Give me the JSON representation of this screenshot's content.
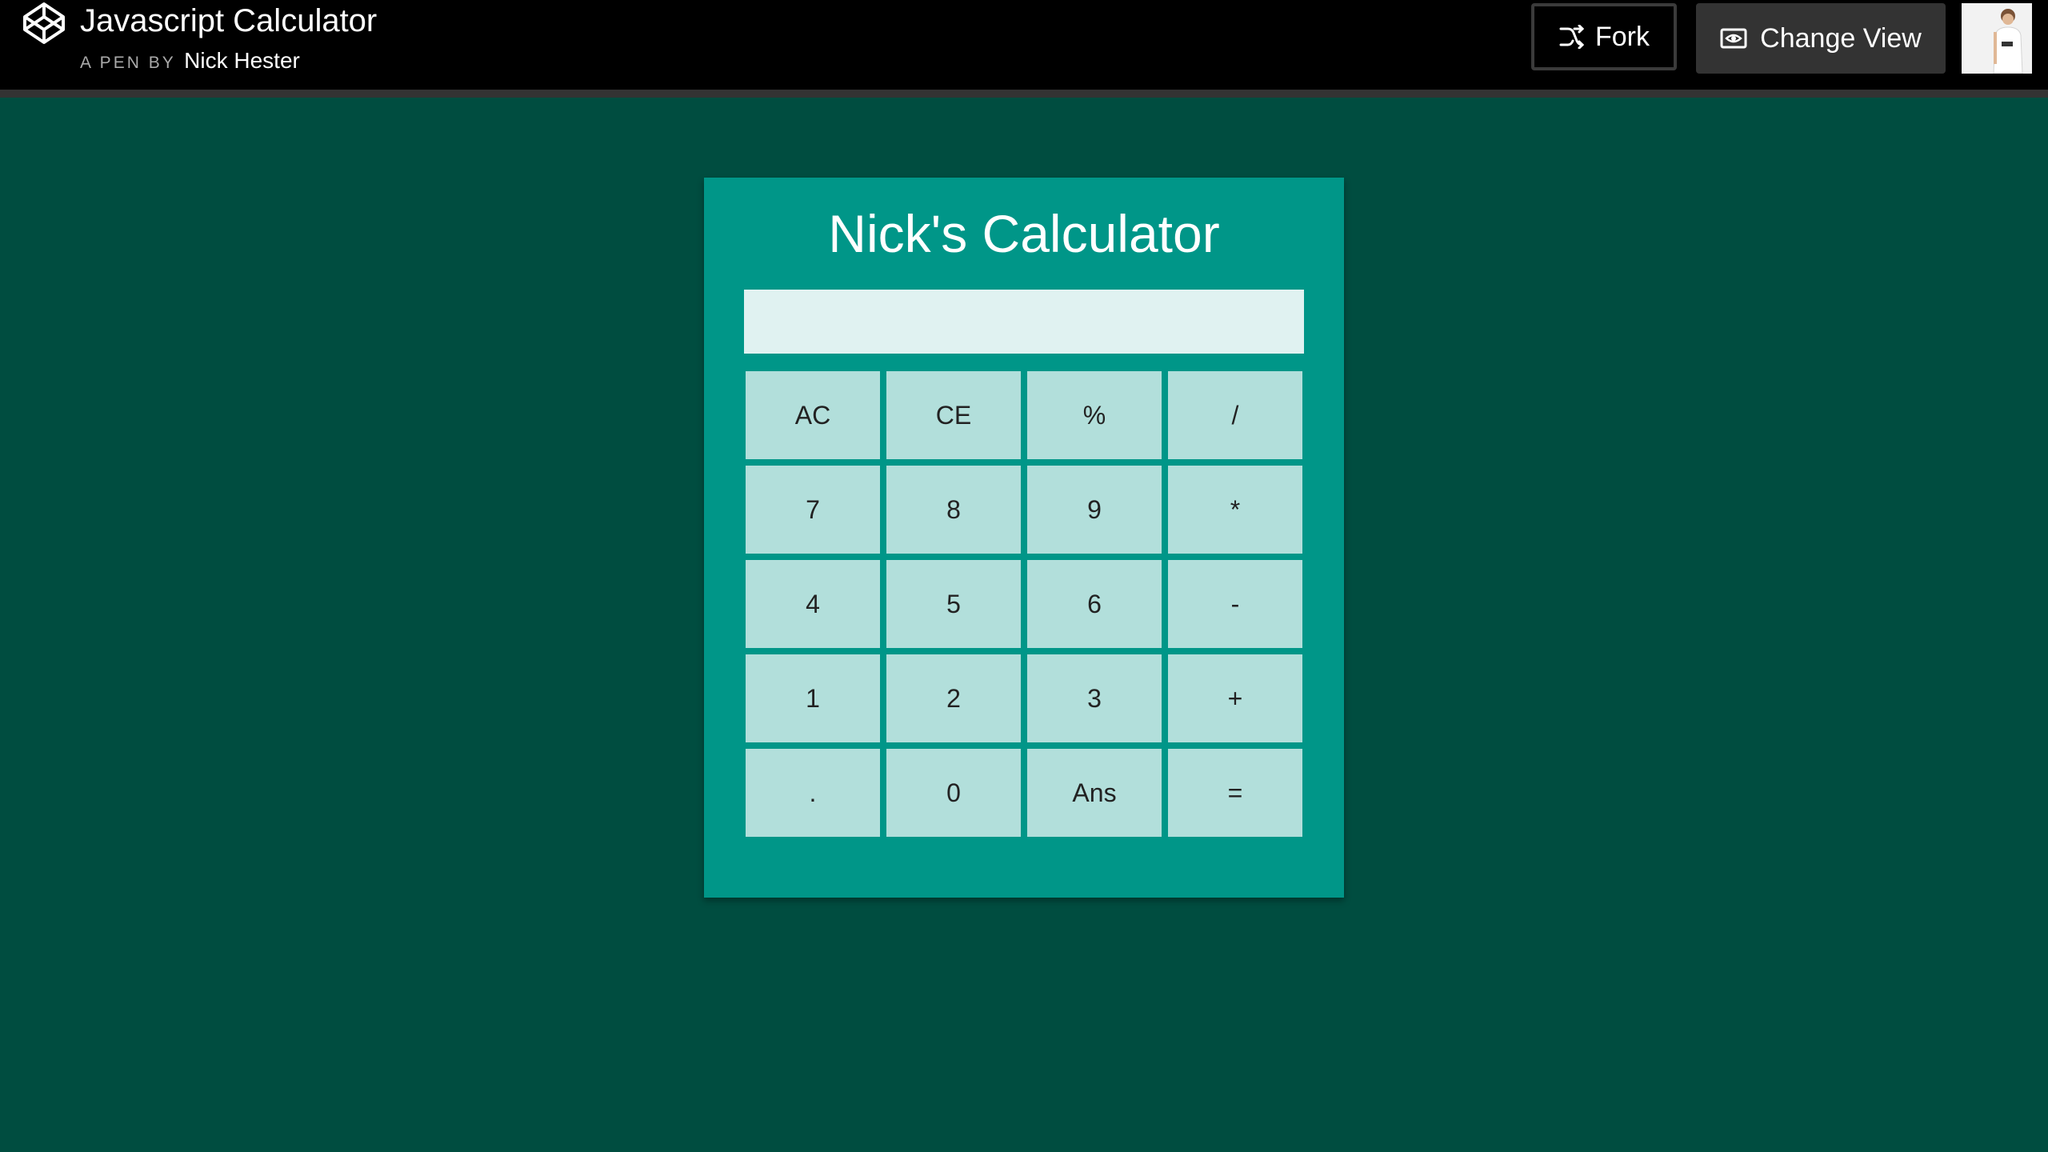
{
  "header": {
    "title": "Javascript Calculator",
    "pen_by": "A PEN BY",
    "author": "Nick Hester",
    "fork_label": "Fork",
    "change_view_label": "Change View",
    "logo_icon": "codepen-logo-icon",
    "fork_icon": "fork-icon",
    "change_view_icon": "eye-icon"
  },
  "calculator": {
    "title": "Nick's Calculator",
    "display_value": "",
    "keys": [
      "AC",
      "CE",
      "%",
      "/",
      "7",
      "8",
      "9",
      "*",
      "4",
      "5",
      "6",
      "-",
      "1",
      "2",
      "3",
      "+",
      ".",
      "0",
      "Ans",
      "="
    ]
  },
  "colors": {
    "page_background": "#004d40",
    "calculator_background": "#009688",
    "display_background": "#e0f2f1",
    "key_background": "#b2dfdb",
    "topbar_background": "#000000",
    "change_view_background": "#333333"
  }
}
